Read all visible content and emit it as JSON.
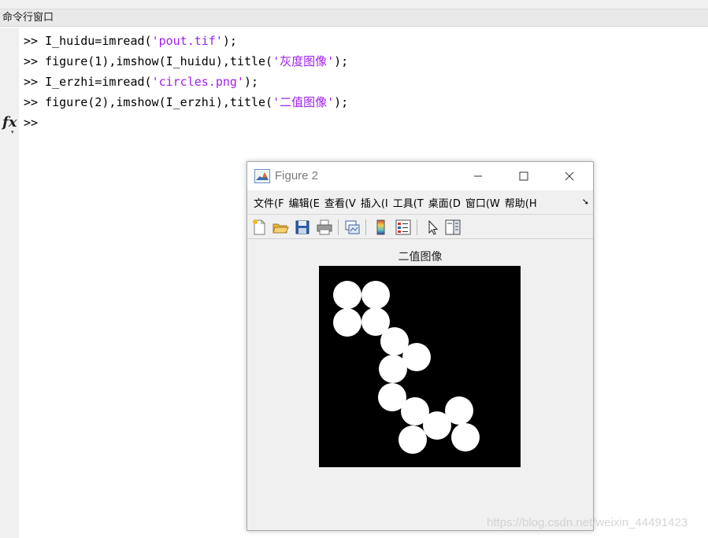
{
  "command_window": {
    "title": "命令行窗口",
    "prompt": ">>",
    "lines": [
      {
        "code": "I_huidu=imread(",
        "string": "'pout.tif'",
        "tail": ");"
      },
      {
        "code": "figure(1),imshow(I_huidu),title(",
        "string": "'灰度图像'",
        "tail": ");"
      },
      {
        "code": "I_erzhi=imread(",
        "string": "'circles.png'",
        "tail": ");"
      },
      {
        "code": "figure(2),imshow(I_erzhi),title(",
        "string": "'二值图像'",
        "tail": ");"
      }
    ],
    "fx_label": "fx",
    "string_color": "#a020f0"
  },
  "figure": {
    "title": "Figure 2",
    "menu": [
      "文件(F",
      "编辑(E",
      "查看(V",
      "插入(I",
      "工具(T",
      "桌面(D",
      "窗口(W",
      "帮助(H"
    ],
    "toolbar_icons": [
      "new-figure-icon",
      "open-file-icon",
      "save-icon",
      "print-icon",
      "link-plot-icon",
      "colorbar-icon",
      "legend-icon",
      "pointer-icon",
      "property-editor-icon"
    ],
    "plot_title": "二值图像"
  },
  "watermark": "https://blog.csdn.net/weixin_44491423"
}
